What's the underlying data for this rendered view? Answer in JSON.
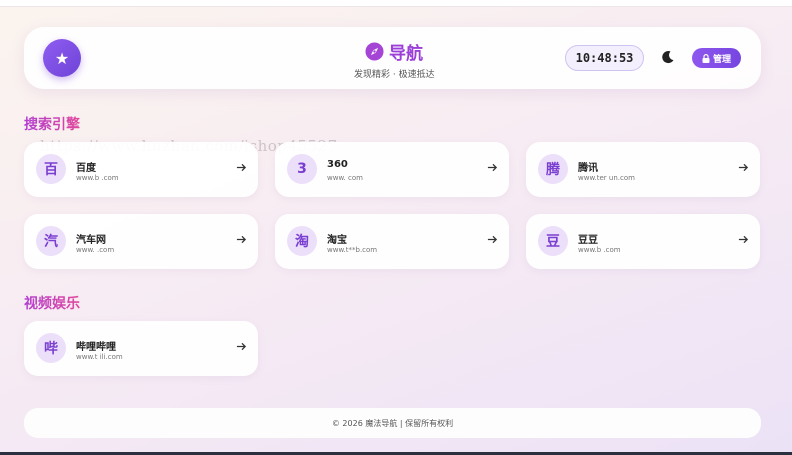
{
  "header": {
    "title": "导航",
    "subtitle": "发现精彩 · 极速抵达",
    "clock": "10:48:53",
    "admin_label": "管理",
    "icons": {
      "star": "star-icon",
      "brand": "compass-icon",
      "theme": "moon-icon",
      "admin": "lock-icon"
    }
  },
  "sections": [
    {
      "title": "搜索引擎",
      "items": [
        {
          "icon_char": "百",
          "name": "百度",
          "url": "www.b      .com"
        },
        {
          "icon_char": "3",
          "name": "360",
          "url": "www.          com"
        },
        {
          "icon_char": "腾",
          "name": "腾讯",
          "url": "www.ter      un.com"
        },
        {
          "icon_char": "汽",
          "name": "汽车网",
          "url": "www.      .com"
        },
        {
          "icon_char": "淘",
          "name": "淘宝",
          "url": "www.t**b.com"
        },
        {
          "icon_char": "豆",
          "name": "豆豆",
          "url": "www.b       .com"
        }
      ]
    },
    {
      "title": "视频娱乐",
      "items": [
        {
          "icon_char": "哔",
          "name": "哔哩哔哩",
          "url": "www.t      ili.com"
        }
      ]
    }
  ],
  "footer": {
    "text": "© 2026 魔法导航 | 保留所有权利"
  },
  "watermark": "https://www.huzhan.com/ishop45527",
  "colors": {
    "accent": "#7c4ae3",
    "title_gradient_start": "#b23fd0",
    "title_gradient_end": "#e0489c",
    "icon_bg": "#ecdffa"
  }
}
